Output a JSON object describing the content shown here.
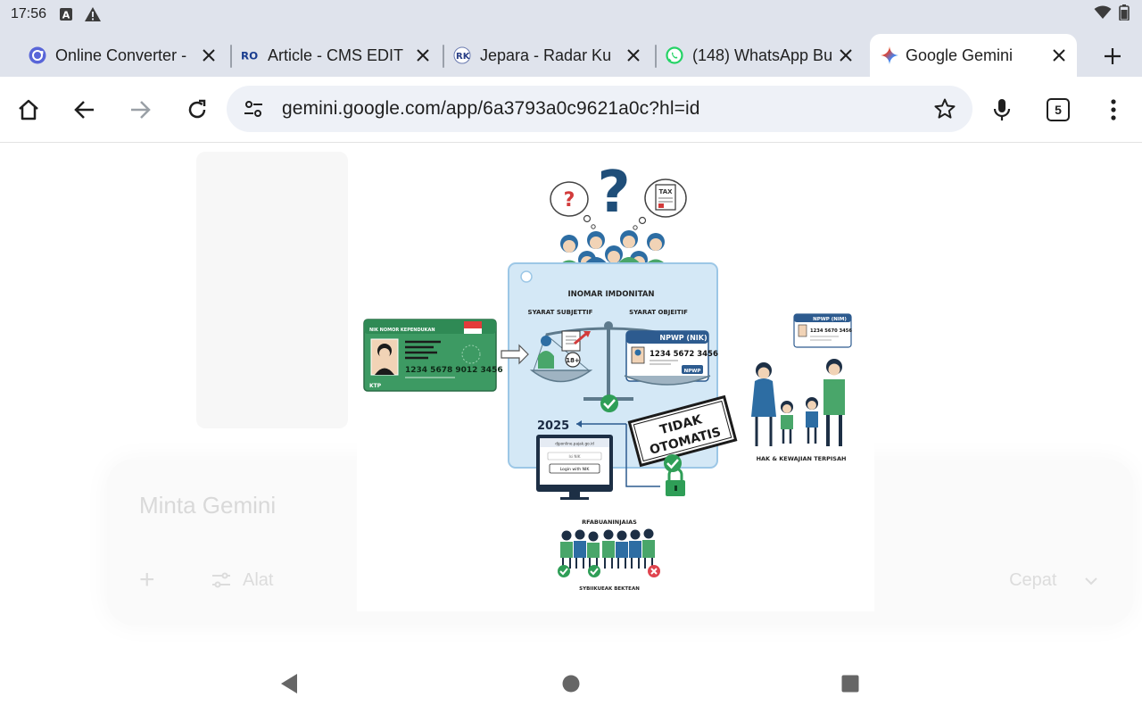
{
  "status": {
    "time": "17:56"
  },
  "tabs": [
    {
      "title": "Online Converter -",
      "favicon": "converter-icon",
      "active": false
    },
    {
      "title": "Article - CMS EDIT",
      "favicon": "ro-logo-icon",
      "active": false
    },
    {
      "title": "Jepara - Radar Ku",
      "favicon": "rk-logo-icon",
      "active": false
    },
    {
      "title": "(148) WhatsApp Bu",
      "favicon": "whatsapp-icon",
      "active": false
    },
    {
      "title": "Google Gemini",
      "favicon": "gemini-icon",
      "active": true
    }
  ],
  "toolbar": {
    "url": "gemini.google.com/app/6a3793a0c9621a0c?hl=id",
    "tab_count": "5"
  },
  "gemini": {
    "input_placeholder": "Minta Gemini",
    "tools_label": "Alat",
    "model_label": "Cepat"
  },
  "infographic": {
    "header": "INOMAR IMDONITAN",
    "left_label": "SYARAT SUBJETTIF",
    "right_label": "SYARAT OBJEITIF",
    "ktp_header": "NIK NOMOR KEPENDUKAN",
    "ktp_number": "1234 5678 9012 3456",
    "ktp_label": "KTP",
    "npwp_title": "NPWP (NIK)",
    "npwp_number": "1234 5672 3456",
    "npwp_tag": "NPWP",
    "npwp_small_title": "NPWP (NIM)",
    "npwp_small_number": "1234 5670 3456",
    "age_badge": "18+",
    "year": "2025",
    "stamp_line1": "TIDAK",
    "stamp_line2": "OTOMATIS",
    "tax_label": "TAX",
    "monitor_url": "djponline.pajak.go.id",
    "monitor_field": "Isi NIK",
    "login_button": "Login with NIK",
    "family_caption": "HAK & KEWAJIAN TERPISAH",
    "bottom_caption_top": "RFABUANINJAIAS",
    "bottom_caption_bottom": "SYBIIKUEAK BEKTEAN"
  }
}
